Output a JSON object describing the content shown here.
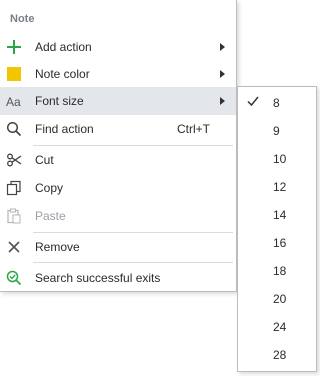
{
  "menu": {
    "header": "Note",
    "items": [
      {
        "label": "Add action",
        "icon": "plus-icon"
      },
      {
        "label": "Note color",
        "icon": "color-swatch-icon",
        "color": "#f3c400"
      },
      {
        "label": "Font size",
        "icon": "font-size-icon"
      },
      {
        "label": "Find action",
        "icon": "search-icon",
        "shortcut": "Ctrl+T"
      },
      {
        "label": "Cut",
        "icon": "scissors-icon"
      },
      {
        "label": "Copy",
        "icon": "copy-icon"
      },
      {
        "label": "Paste",
        "icon": "paste-icon",
        "disabled": true
      },
      {
        "label": "Remove",
        "icon": "close-icon"
      },
      {
        "label": "Search successful exits",
        "icon": "search-check-icon"
      }
    ]
  },
  "font_size_submenu": {
    "selected": "8",
    "options": [
      "8",
      "9",
      "10",
      "12",
      "14",
      "16",
      "18",
      "20",
      "24",
      "28"
    ]
  },
  "colors": {
    "accent_green": "#27a745",
    "hover_bg": "#e3e6ea",
    "header_text": "#7a7f88"
  }
}
